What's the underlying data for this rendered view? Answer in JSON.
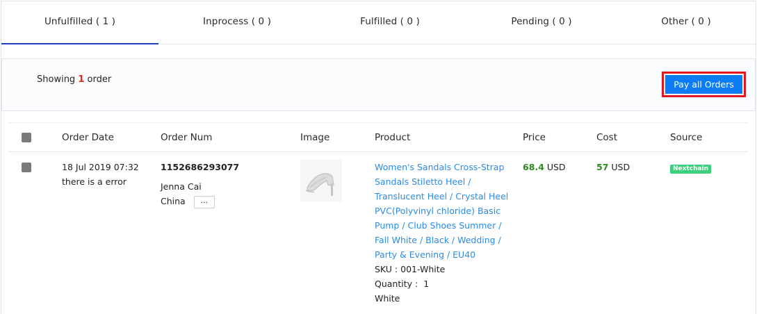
{
  "tabs": [
    {
      "label": "Unfulfilled ( 1 )",
      "active": true
    },
    {
      "label": "Inprocess ( 0 )",
      "active": false
    },
    {
      "label": "Fulfilled ( 0 )",
      "active": false
    },
    {
      "label": "Pending ( 0 )",
      "active": false
    },
    {
      "label": "Other ( 0 )",
      "active": false
    }
  ],
  "summary": {
    "showing_prefix": "Showing",
    "showing_count": "1",
    "showing_suffix": "order",
    "pay_all_label": "Pay all Orders"
  },
  "table": {
    "headers": [
      "Order Date",
      "Order Num",
      "Image",
      "Product",
      "Price",
      "Cost",
      "Source"
    ],
    "rows": [
      {
        "date": "18 Jul 2019 07:32",
        "error": "there is a error",
        "order_num": "1152686293077",
        "customer": "Jenna Cai",
        "country": "China",
        "more_label": "...",
        "image_icon": "sandal-product-thumbnail",
        "product_lines": [
          "Women's Sandals Cross-Strap",
          "Sandals Stiletto Heel /",
          "Translucent Heel / Crystal Heel",
          "PVC(Polyvinyl chloride) Basic",
          "Pump / Club Shoes Summer /",
          "Fall White / Black / Wedding /",
          "Party & Evening / EU40"
        ],
        "sku_label": "SKU :",
        "sku": "001-White",
        "quantity_label": "Quantity :",
        "quantity": "1",
        "variant": "White",
        "price": "68.4",
        "price_currency": "USD",
        "cost": "57",
        "cost_currency": "USD",
        "source": "Nextchain"
      }
    ]
  },
  "colors": {
    "accent": "#0a7cf5",
    "tab_underline": "#1c39c9",
    "highlight_border": "#e4171f",
    "link": "#2a8be8",
    "price_green": "#2d8a1e",
    "badge_green": "#3ccf7c"
  }
}
